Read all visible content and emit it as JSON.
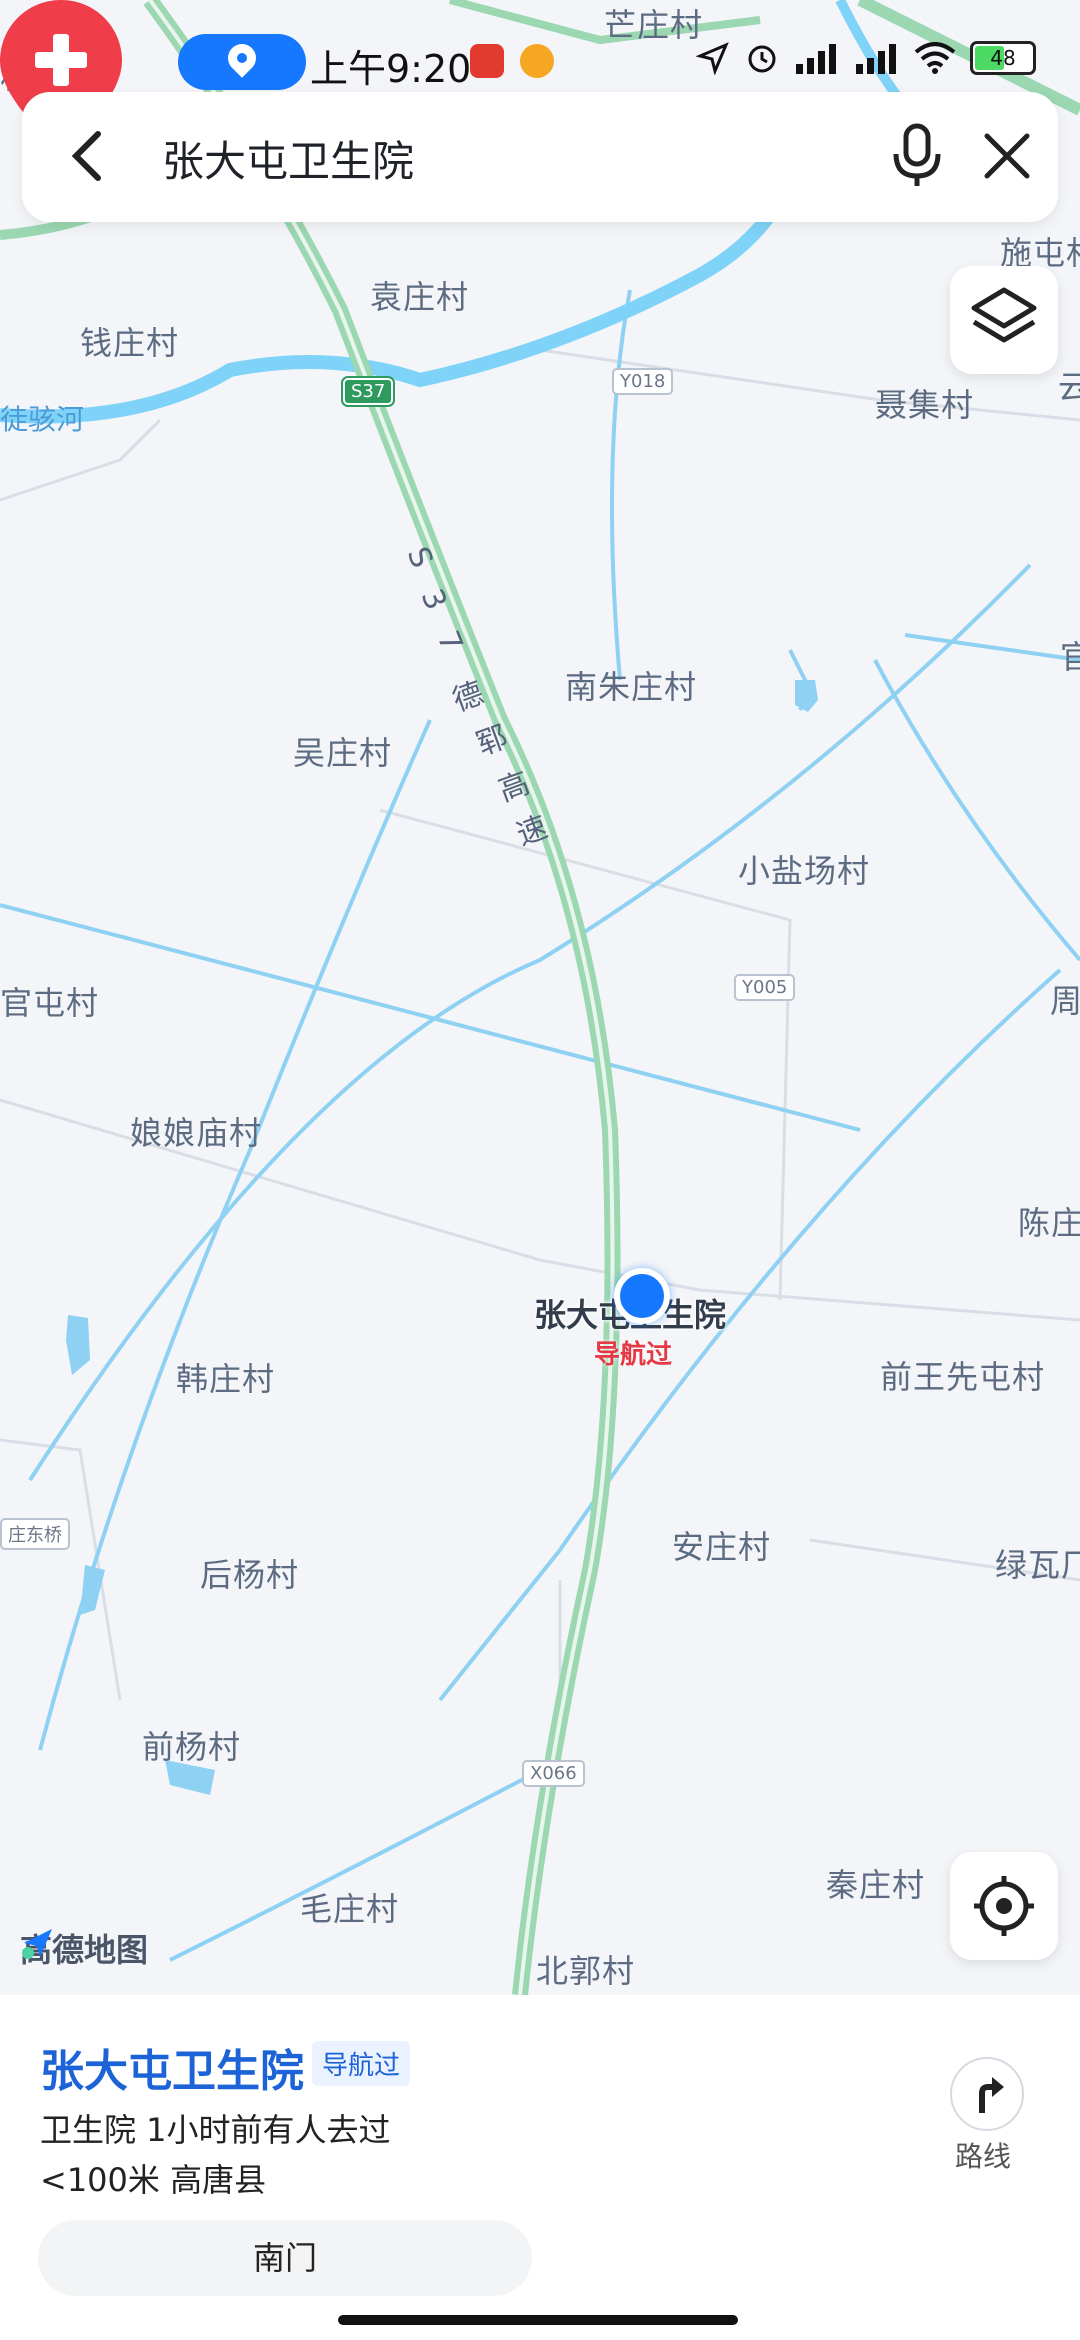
{
  "status_bar": {
    "time": "上午9:20",
    "battery": "48"
  },
  "search": {
    "query": "张大屯卫生院"
  },
  "map": {
    "places": [
      {
        "name": "芒庄村"
      },
      {
        "name": "袁庄村"
      },
      {
        "name": "钱庄村"
      },
      {
        "name": "施屯村"
      },
      {
        "name": "聂集村"
      },
      {
        "name": "南朱庄村"
      },
      {
        "name": "吴庄村"
      },
      {
        "name": "小盐场村"
      },
      {
        "name": "官屯村"
      },
      {
        "name": "娘娘庙村"
      },
      {
        "name": "陈庄"
      },
      {
        "name": "韩庄村"
      },
      {
        "name": "前王先屯村"
      },
      {
        "name": "安庄村"
      },
      {
        "name": "后杨村"
      },
      {
        "name": "绿瓦厂"
      },
      {
        "name": "前杨村"
      },
      {
        "name": "秦庄村"
      },
      {
        "name": "毛庄村"
      },
      {
        "name": "北郭村"
      },
      {
        "name": "周"
      },
      {
        "name": "云"
      },
      {
        "name": "官"
      },
      {
        "name": "村"
      }
    ],
    "river_label": "徒骇河",
    "road_badges": {
      "s37": "S37",
      "y018": "Y018",
      "y005": "Y005",
      "x066": "X066",
      "east_bridge": "庄东桥"
    },
    "highway_chars": [
      "S",
      "3",
      "7",
      "德",
      "郓",
      "高",
      "速"
    ],
    "poi": {
      "name": "张大屯卫生院",
      "status": "导航过"
    },
    "logo_text": "高德地图"
  },
  "card": {
    "title": "张大屯卫生院",
    "tag": "导航过",
    "line1": "卫生院  1小时前有人去过",
    "line2": "<100米  高唐县",
    "route_label": "路线",
    "gate_chip": "南门"
  }
}
